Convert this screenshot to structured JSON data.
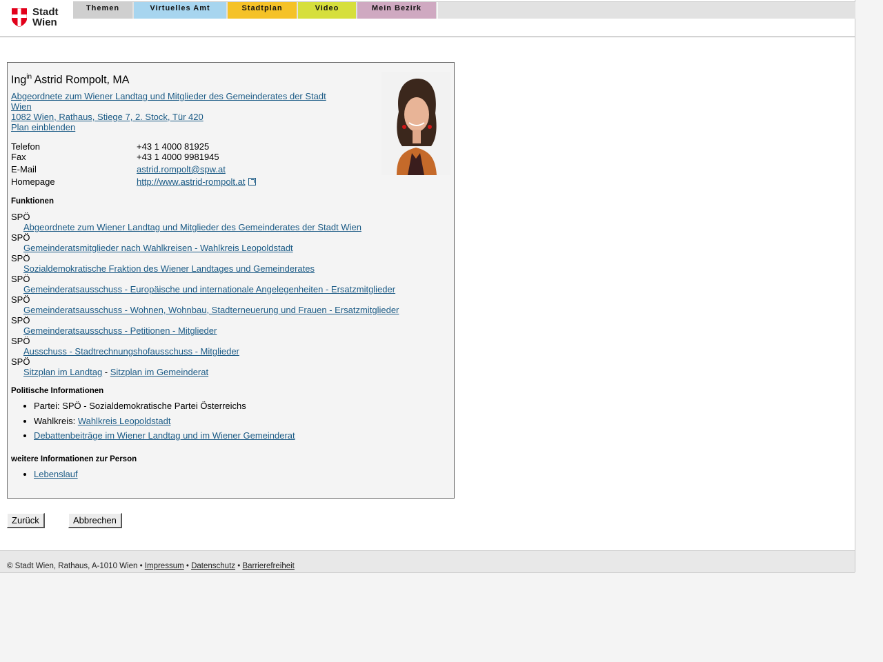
{
  "header": {
    "logo_line1": "Stadt",
    "logo_line2": "Wien",
    "tabs": [
      "Themen",
      "Virtuelles Amt",
      "Stadtplan",
      "Video",
      "Mein Bezirk"
    ]
  },
  "person": {
    "title_prefix": "Ing",
    "title_sup": "in",
    "name": "Astrid Rompolt, MA",
    "role_link_1": "Abgeordnete zum Wiener Landtag und Mitglieder des Gemeinderates der Stadt",
    "role_link_2": "Wien",
    "address": "1082 Wien, Rathaus, Stiege 7, 2. Stock, Tür 420",
    "plan_link": "Plan einblenden",
    "contact": {
      "phone_label": "Telefon",
      "phone": "+43 1 4000 81925",
      "fax_label": "Fax",
      "fax": "+43 1 4000 9981945",
      "email_label": "E-Mail",
      "email": "astrid.rompolt@spw.at",
      "homepage_label": "Homepage",
      "homepage": "http://www.astrid-rompolt.at"
    }
  },
  "functions": {
    "heading": "Funktionen",
    "items": [
      {
        "party": "SPÖ",
        "link": "Abgeordnete zum Wiener Landtag und Mitglieder des Gemeinderates der Stadt Wien"
      },
      {
        "party": "SPÖ",
        "link": "Gemeinderatsmitglieder nach Wahlkreisen - Wahlkreis Leopoldstadt"
      },
      {
        "party": "SPÖ",
        "link": "Sozialdemokratische Fraktion des Wiener Landtages und Gemeinderates"
      },
      {
        "party": "SPÖ",
        "link": "Gemeinderatsausschuss - Europäische und internationale Angelegenheiten - Ersatzmitglieder"
      },
      {
        "party": "SPÖ",
        "link": "Gemeinderatsausschuss - Wohnen, Wohnbau, Stadterneuerung und Frauen - Ersatzmitglieder"
      },
      {
        "party": "SPÖ",
        "link": "Gemeinderatsausschuss - Petitionen - Mitglieder"
      },
      {
        "party": "SPÖ",
        "link": "Ausschuss - Stadtrechnungshofausschuss - Mitglieder"
      }
    ],
    "last_party": "SPÖ",
    "seat_landtag": "Sitzplan im Landtag",
    "seat_separator": " - ",
    "seat_gemeinderat": "Sitzplan im Gemeinderat"
  },
  "political": {
    "heading": "Politische Informationen",
    "party_text": "Partei: SPÖ - Sozialdemokratische Partei Österreichs",
    "district_label": "Wahlkreis: ",
    "district_link": "Wahlkreis Leopoldstadt",
    "debate_link": "Debattenbeiträge im Wiener Landtag und im Wiener Gemeinderat"
  },
  "more": {
    "heading": "weitere Informationen zur Person",
    "cv_link": "Lebenslauf"
  },
  "buttons": {
    "back": "Zurück",
    "cancel": "Abbrechen"
  },
  "footer": {
    "copyright": "© Stadt Wien, Rathaus, A-1010 Wien",
    "sep": " • ",
    "impressum": "Impressum",
    "datenschutz": "Datenschutz",
    "barrierefreiheit": "Barrierefreiheit"
  }
}
